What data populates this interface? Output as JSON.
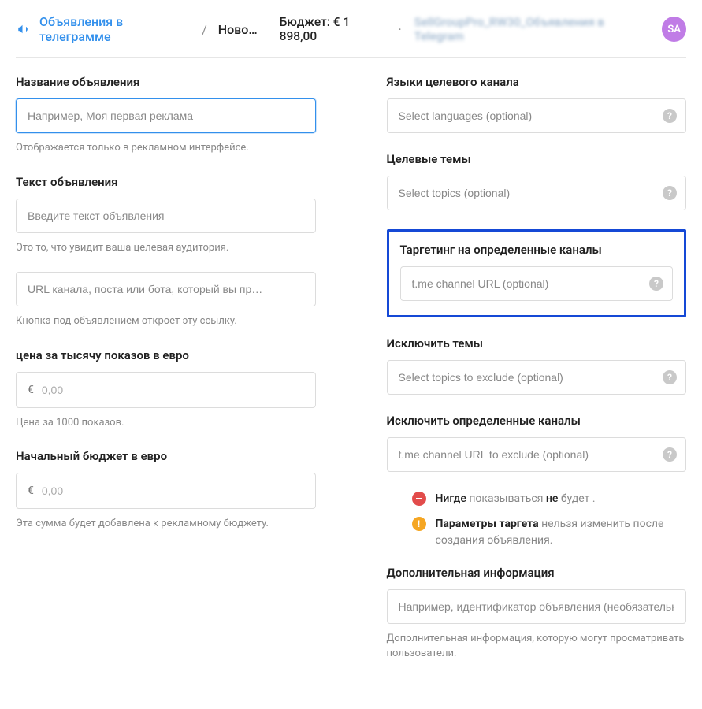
{
  "header": {
    "breadcrumb_link": "Объявления в телеграмме",
    "breadcrumb_sep": "/",
    "breadcrumb_current": "Ново…",
    "budget_label": "Бюджет: € 1 898,00",
    "budget_sep": "·",
    "blurred": "SellGroupPro_RW30_Объявления в Telegram",
    "avatar": "SA"
  },
  "left": {
    "name": {
      "label": "Название объявления",
      "placeholder": "Например, Моя первая реклама",
      "helper": "Отображается только в рекламном интерфейсе."
    },
    "text": {
      "label": "Текст объявления",
      "placeholder": "Введите текст объявления",
      "helper": "Это то, что увидит ваша целевая аудитория."
    },
    "url": {
      "placeholder": "URL канала, поста или бота, который вы пр…",
      "helper": "Кнопка под объявлением откроет эту ссылку."
    },
    "cpm": {
      "label": "цена за тысячу показов в евро",
      "currency": "€",
      "placeholder": "0,00",
      "helper": "Цена за 1000 показов."
    },
    "budget": {
      "label": "Начальный бюджет в евро",
      "currency": "€",
      "placeholder": "0,00",
      "helper": "Эта сумма будет добавлена к рекламному бюджету."
    }
  },
  "right": {
    "languages": {
      "label": "Языки целевого канала",
      "placeholder": "Select languages (optional)"
    },
    "topics": {
      "label": "Целевые темы",
      "placeholder": "Select topics (optional)"
    },
    "target_channels": {
      "label": "Таргетинг на определенные каналы",
      "placeholder": "t.me channel URL (optional)"
    },
    "exclude_topics": {
      "label": "Исключить темы",
      "placeholder": "Select topics to exclude (optional)"
    },
    "exclude_channels": {
      "label": "Исключить определенные каналы",
      "placeholder": "t.me channel URL to exclude (optional)"
    },
    "notice_nowhere": {
      "prefix": "Нигде ",
      "mid": "показываться ",
      "mid2": "не ",
      "suffix": "будет ."
    },
    "notice_params": {
      "bold": "Параметры таргета ",
      "rest": "нельзя изменить после создания объявления."
    },
    "extra": {
      "label": "Дополнительная информация",
      "placeholder": "Например, идентификатор объявления (необязательно)",
      "helper": "Дополнительная информация, которую могут просматривать пользователи."
    }
  }
}
